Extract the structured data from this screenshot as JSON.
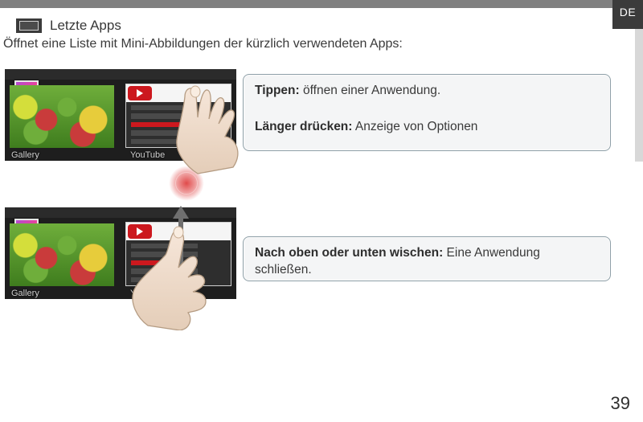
{
  "lang_tab": "DE",
  "heading": {
    "title": "Letzte Apps"
  },
  "intro": "Öffnet eine Liste mit Mini-Abbildungen der kürzlich verwendeten Apps:",
  "labels": {
    "gallery": "Gallery",
    "youtube": "YouTube"
  },
  "callout1": {
    "tap_label": "Tippen:",
    "tap_text": " öffnen einer Anwendung.",
    "hold_label": "Länger drücken:",
    "hold_text": " Anzeige von Optionen"
  },
  "callout2": {
    "swipe_label": "Nach oben oder unten wischen:",
    "swipe_text": " Eine Anwendung schließen."
  },
  "page_number": "39",
  "icons": {
    "recent": "recent-apps-icon",
    "play": "play-icon",
    "swipe": "swipe-updown-icon",
    "hand": "hand-icon",
    "touch": "touch-ripple-icon",
    "appthumb": "app-thumbnail-icon"
  }
}
